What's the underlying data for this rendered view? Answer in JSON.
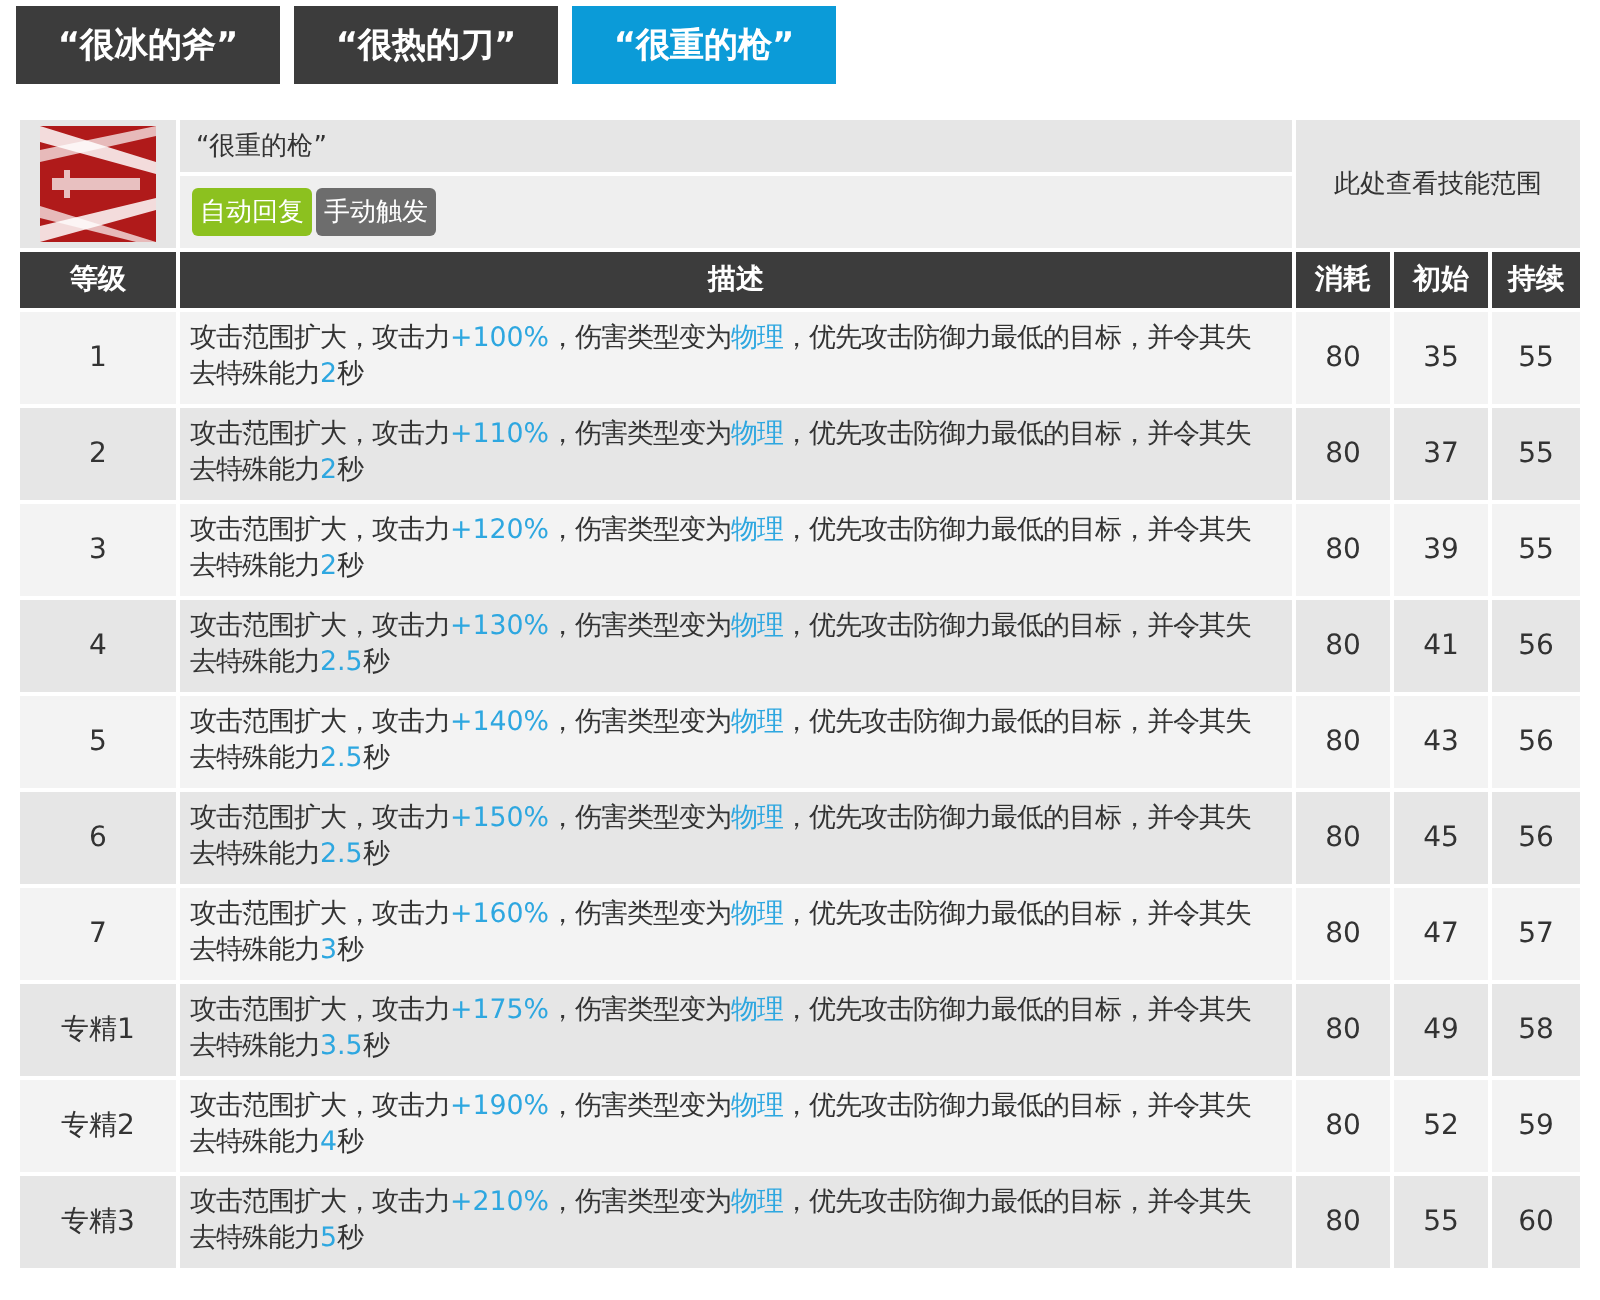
{
  "tabs": [
    {
      "label": "“很冰的斧”",
      "selected": false
    },
    {
      "label": "“很热的刀”",
      "selected": false
    },
    {
      "label": "“很重的枪”",
      "selected": true
    }
  ],
  "skill": {
    "name": "“很重的枪”",
    "tags": [
      {
        "label": "自动回复",
        "kind": "recovery"
      },
      {
        "label": "手动触发",
        "kind": "trigger"
      }
    ],
    "range_link": "此处查看技能范围"
  },
  "table": {
    "columns": [
      "等级",
      "描述",
      "消耗",
      "初始",
      "持续"
    ],
    "rows": [
      {
        "level": "1",
        "description": [
          {
            "text": "攻击范围扩大，攻击力",
            "highlight": false
          },
          {
            "text": "+100%",
            "highlight": true
          },
          {
            "text": "，伤害类型变为",
            "highlight": false
          },
          {
            "text": "物理",
            "highlight": true
          },
          {
            "text": "，优先攻击防御力最低的目标，并令其失去特殊能力",
            "highlight": false
          },
          {
            "text": "2",
            "highlight": true
          },
          {
            "text": "秒",
            "highlight": false
          }
        ],
        "cost": "80",
        "initial": "35",
        "duration": "55"
      },
      {
        "level": "2",
        "description": [
          {
            "text": "攻击范围扩大，攻击力",
            "highlight": false
          },
          {
            "text": "+110%",
            "highlight": true
          },
          {
            "text": "，伤害类型变为",
            "highlight": false
          },
          {
            "text": "物理",
            "highlight": true
          },
          {
            "text": "，优先攻击防御力最低的目标，并令其失去特殊能力",
            "highlight": false
          },
          {
            "text": "2",
            "highlight": true
          },
          {
            "text": "秒",
            "highlight": false
          }
        ],
        "cost": "80",
        "initial": "37",
        "duration": "55"
      },
      {
        "level": "3",
        "description": [
          {
            "text": "攻击范围扩大，攻击力",
            "highlight": false
          },
          {
            "text": "+120%",
            "highlight": true
          },
          {
            "text": "，伤害类型变为",
            "highlight": false
          },
          {
            "text": "物理",
            "highlight": true
          },
          {
            "text": "，优先攻击防御力最低的目标，并令其失去特殊能力",
            "highlight": false
          },
          {
            "text": "2",
            "highlight": true
          },
          {
            "text": "秒",
            "highlight": false
          }
        ],
        "cost": "80",
        "initial": "39",
        "duration": "55"
      },
      {
        "level": "4",
        "description": [
          {
            "text": "攻击范围扩大，攻击力",
            "highlight": false
          },
          {
            "text": "+130%",
            "highlight": true
          },
          {
            "text": "，伤害类型变为",
            "highlight": false
          },
          {
            "text": "物理",
            "highlight": true
          },
          {
            "text": "，优先攻击防御力最低的目标，并令其失去特殊能力",
            "highlight": false
          },
          {
            "text": "2.5",
            "highlight": true
          },
          {
            "text": "秒",
            "highlight": false
          }
        ],
        "cost": "80",
        "initial": "41",
        "duration": "56"
      },
      {
        "level": "5",
        "description": [
          {
            "text": "攻击范围扩大，攻击力",
            "highlight": false
          },
          {
            "text": "+140%",
            "highlight": true
          },
          {
            "text": "，伤害类型变为",
            "highlight": false
          },
          {
            "text": "物理",
            "highlight": true
          },
          {
            "text": "，优先攻击防御力最低的目标，并令其失去特殊能力",
            "highlight": false
          },
          {
            "text": "2.5",
            "highlight": true
          },
          {
            "text": "秒",
            "highlight": false
          }
        ],
        "cost": "80",
        "initial": "43",
        "duration": "56"
      },
      {
        "level": "6",
        "description": [
          {
            "text": "攻击范围扩大，攻击力",
            "highlight": false
          },
          {
            "text": "+150%",
            "highlight": true
          },
          {
            "text": "，伤害类型变为",
            "highlight": false
          },
          {
            "text": "物理",
            "highlight": true
          },
          {
            "text": "，优先攻击防御力最低的目标，并令其失去特殊能力",
            "highlight": false
          },
          {
            "text": "2.5",
            "highlight": true
          },
          {
            "text": "秒",
            "highlight": false
          }
        ],
        "cost": "80",
        "initial": "45",
        "duration": "56"
      },
      {
        "level": "7",
        "description": [
          {
            "text": "攻击范围扩大，攻击力",
            "highlight": false
          },
          {
            "text": "+160%",
            "highlight": true
          },
          {
            "text": "，伤害类型变为",
            "highlight": false
          },
          {
            "text": "物理",
            "highlight": true
          },
          {
            "text": "，优先攻击防御力最低的目标，并令其失去特殊能力",
            "highlight": false
          },
          {
            "text": "3",
            "highlight": true
          },
          {
            "text": "秒",
            "highlight": false
          }
        ],
        "cost": "80",
        "initial": "47",
        "duration": "57"
      },
      {
        "level": "专精1",
        "description": [
          {
            "text": "攻击范围扩大，攻击力",
            "highlight": false
          },
          {
            "text": "+175%",
            "highlight": true
          },
          {
            "text": "，伤害类型变为",
            "highlight": false
          },
          {
            "text": "物理",
            "highlight": true
          },
          {
            "text": "，优先攻击防御力最低的目标，并令其失去特殊能力",
            "highlight": false
          },
          {
            "text": "3.5",
            "highlight": true
          },
          {
            "text": "秒",
            "highlight": false
          }
        ],
        "cost": "80",
        "initial": "49",
        "duration": "58"
      },
      {
        "level": "专精2",
        "description": [
          {
            "text": "攻击范围扩大，攻击力",
            "highlight": false
          },
          {
            "text": "+190%",
            "highlight": true
          },
          {
            "text": "，伤害类型变为",
            "highlight": false
          },
          {
            "text": "物理",
            "highlight": true
          },
          {
            "text": "，优先攻击防御力最低的目标，并令其失去特殊能力",
            "highlight": false
          },
          {
            "text": "4",
            "highlight": true
          },
          {
            "text": "秒",
            "highlight": false
          }
        ],
        "cost": "80",
        "initial": "52",
        "duration": "59"
      },
      {
        "level": "专精3",
        "description": [
          {
            "text": "攻击范围扩大，攻击力",
            "highlight": false
          },
          {
            "text": "+210%",
            "highlight": true
          },
          {
            "text": "，伤害类型变为",
            "highlight": false
          },
          {
            "text": "物理",
            "highlight": true
          },
          {
            "text": "，优先攻击防御力最低的目标，并令其失去特殊能力",
            "highlight": false
          },
          {
            "text": "5",
            "highlight": true
          },
          {
            "text": "秒",
            "highlight": false
          }
        ],
        "cost": "80",
        "initial": "55",
        "duration": "60"
      }
    ]
  }
}
